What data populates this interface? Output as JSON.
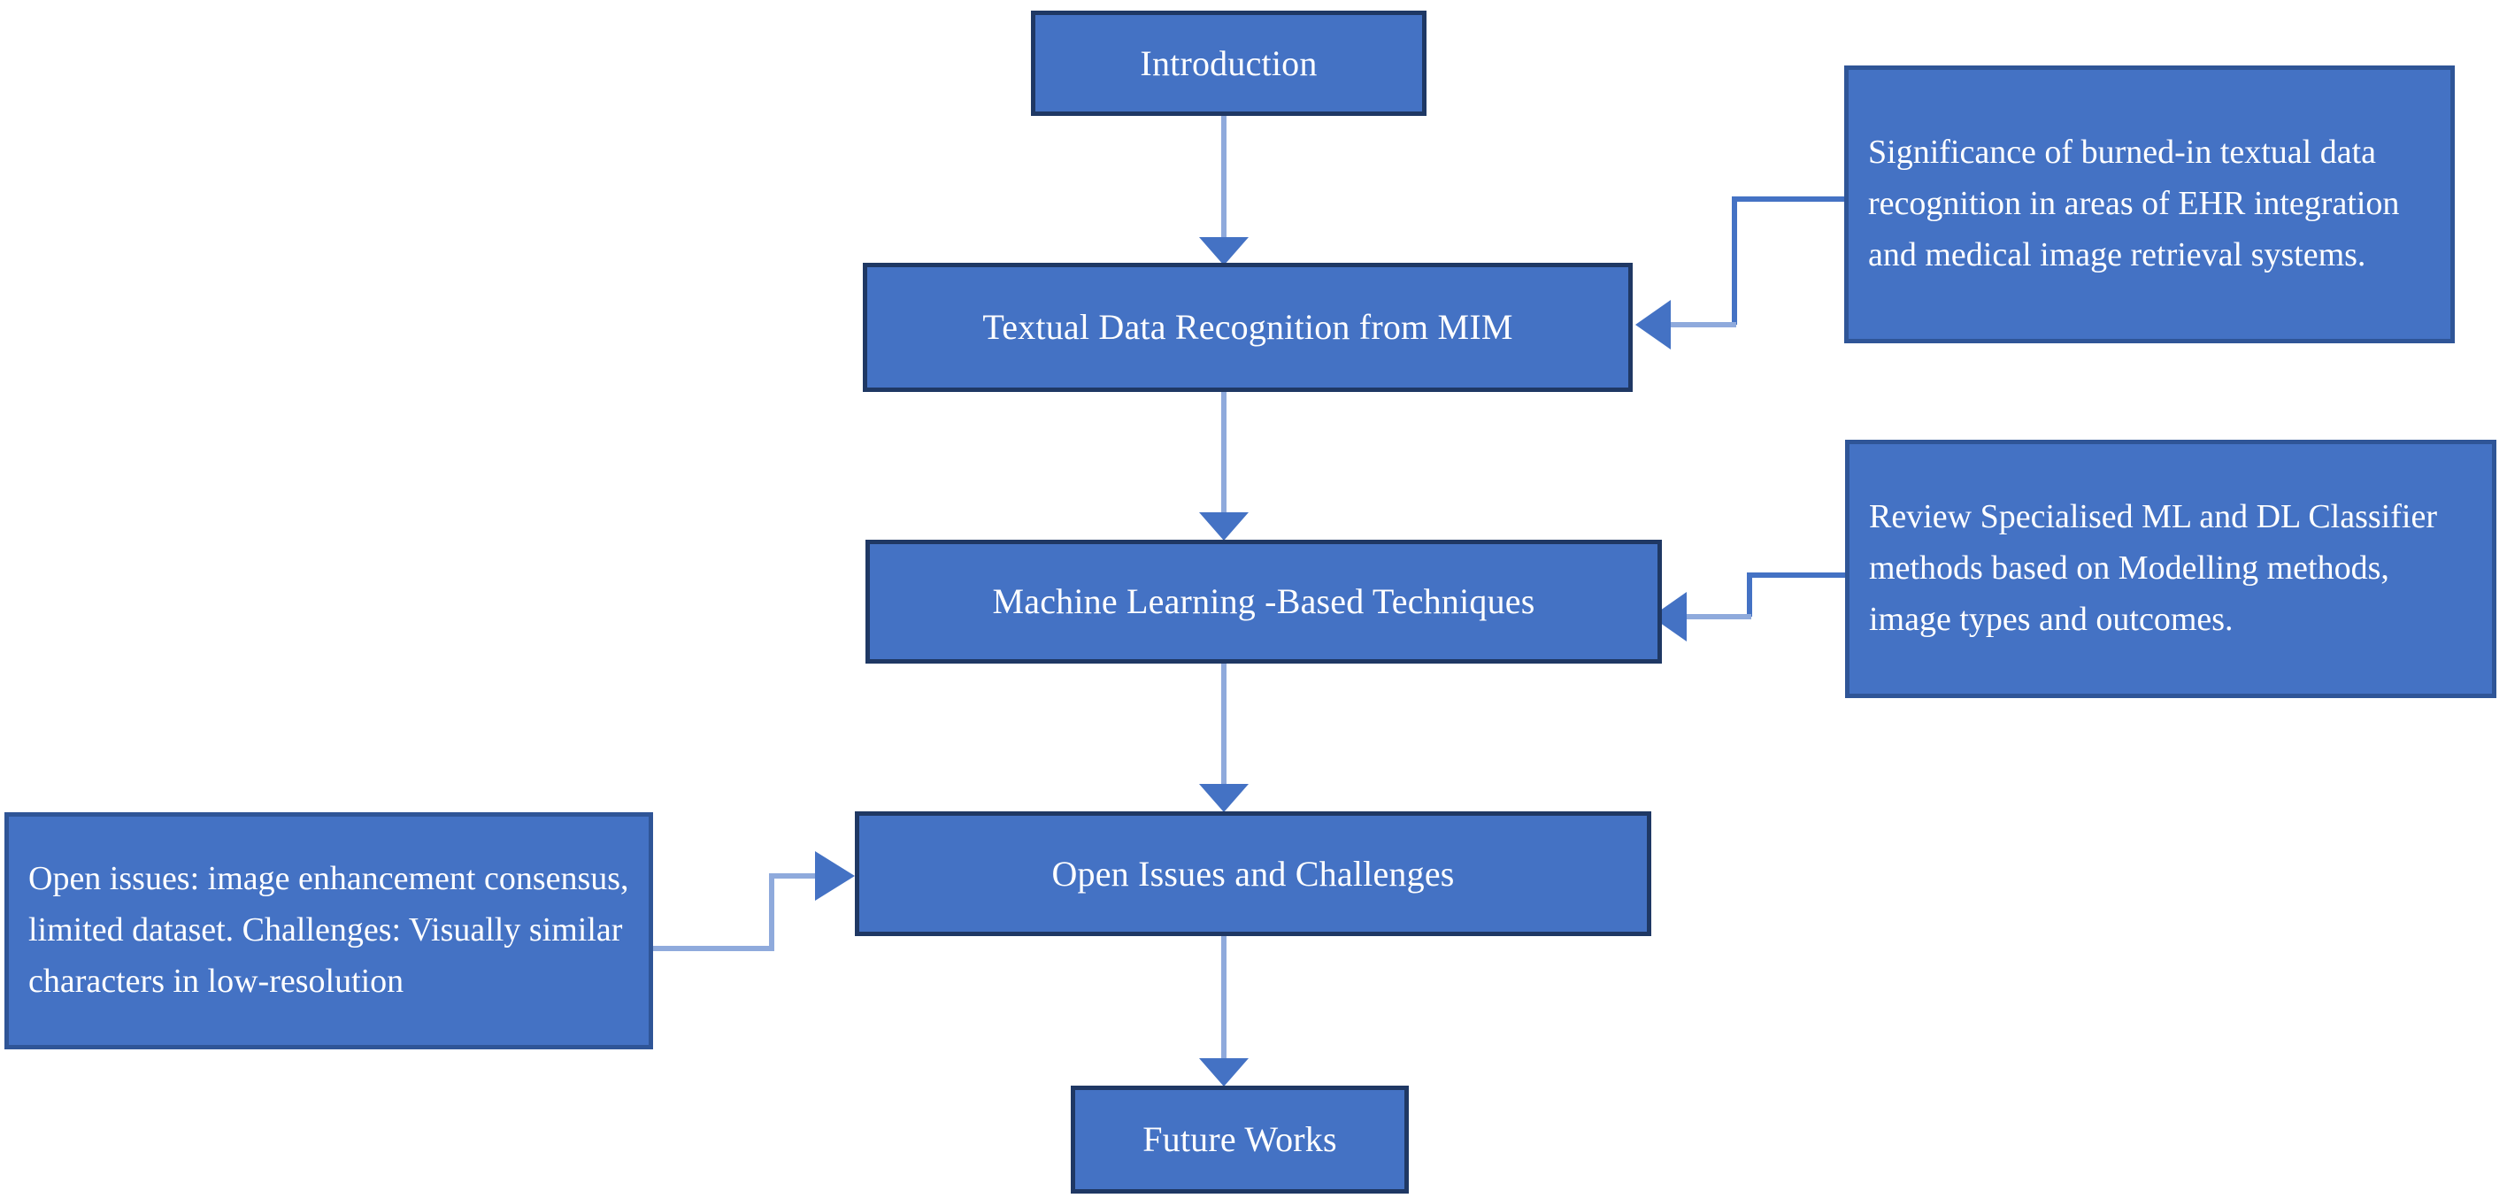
{
  "diagram": {
    "title": "Textual Data Recognition from Medical Imaging Survey Flowchart",
    "colors": {
      "node_fill": "#4472C4",
      "node_border": "#1F3864",
      "note_fill": "#4472C4",
      "note_border": "#2F5597",
      "connector": "#8FAADC",
      "connector_head": "#4472C4",
      "text": "#FFFFFF",
      "background": "#FFFFFF"
    },
    "nodes": [
      {
        "id": "introduction",
        "label": "Introduction"
      },
      {
        "id": "textual-data-recognition",
        "label": "Textual Data Recognition from MIM"
      },
      {
        "id": "machine-learning-techniques",
        "label": "Machine Learning -Based Techniques"
      },
      {
        "id": "open-issues-challenges",
        "label": "Open Issues and Challenges"
      },
      {
        "id": "future-works",
        "label": "Future Works"
      }
    ],
    "notes": [
      {
        "id": "note-significance",
        "label": "Significance of burned-in textual data recognition in areas of EHR integration and medical image retrieval systems.",
        "attaches_to": "textual-data-recognition"
      },
      {
        "id": "note-review",
        "label": "Review Specialised ML and DL Classifier methods based on Modelling methods, image types and outcomes.",
        "attaches_to": "machine-learning-techniques"
      },
      {
        "id": "note-open-issues",
        "label": "Open issues: image enhancement consensus, limited dataset. Challenges: Visually similar characters in low-resolution",
        "attaches_to": "open-issues-challenges"
      }
    ],
    "flow": [
      {
        "from": "introduction",
        "to": "textual-data-recognition"
      },
      {
        "from": "textual-data-recognition",
        "to": "machine-learning-techniques"
      },
      {
        "from": "machine-learning-techniques",
        "to": "open-issues-challenges"
      },
      {
        "from": "open-issues-challenges",
        "to": "future-works"
      },
      {
        "from": "note-significance",
        "to": "textual-data-recognition"
      },
      {
        "from": "note-review",
        "to": "machine-learning-techniques"
      },
      {
        "from": "note-open-issues",
        "to": "open-issues-challenges"
      }
    ]
  }
}
